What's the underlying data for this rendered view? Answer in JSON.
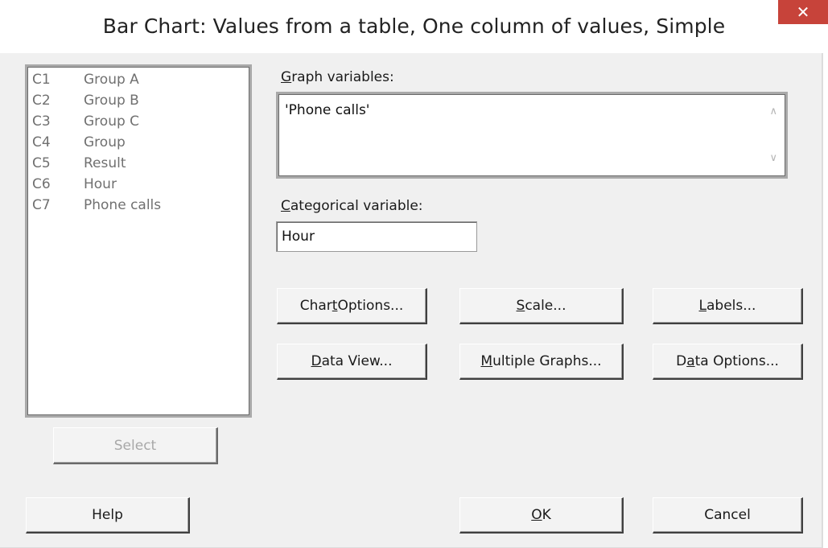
{
  "window": {
    "title": "Bar Chart: Values from a table, One column of values, Simple",
    "close_glyph": "✕"
  },
  "variables": [
    {
      "id": "C1",
      "name": "Group A"
    },
    {
      "id": "C2",
      "name": "Group B"
    },
    {
      "id": "C3",
      "name": "Group C"
    },
    {
      "id": "C4",
      "name": "Group"
    },
    {
      "id": "C5",
      "name": "Result"
    },
    {
      "id": "C6",
      "name": "Hour"
    },
    {
      "id": "C7",
      "name": "Phone calls"
    }
  ],
  "graph_variables": {
    "label_key": "G",
    "label_rest": "raph variables:",
    "value": "'Phone calls'"
  },
  "categorical_variable": {
    "label_key": "C",
    "label_rest": "ategorical variable:",
    "value": "Hour"
  },
  "buttons": {
    "chart_options": {
      "pre": "Char",
      "key": "t",
      "post": " Options..."
    },
    "scale": {
      "pre": "",
      "key": "S",
      "post": "cale..."
    },
    "labels": {
      "pre": "",
      "key": "L",
      "post": "abels..."
    },
    "data_view": {
      "pre": "",
      "key": "D",
      "post": "ata View..."
    },
    "multiple_graphs": {
      "pre": "",
      "key": "M",
      "post": "ultiple Graphs..."
    },
    "data_options": {
      "pre": "D",
      "key": "a",
      "post": "ta Options..."
    },
    "select": "Select",
    "help": "Help",
    "ok": {
      "pre": "",
      "key": "O",
      "post": "K"
    },
    "cancel": "Cancel"
  }
}
